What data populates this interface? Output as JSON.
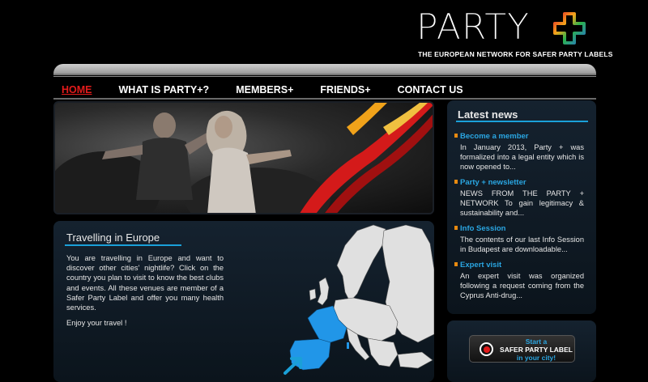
{
  "logo": {
    "word": "PARTY",
    "tagline": "THE EUROPEAN NETWORK FOR SAFER PARTY LABELS"
  },
  "nav": {
    "items": [
      {
        "label": "HOME",
        "active": true
      },
      {
        "label": "WHAT IS PARTY+?",
        "active": false
      },
      {
        "label": "MEMBERS+",
        "active": false
      },
      {
        "label": "FRIENDS+",
        "active": false
      },
      {
        "label": "CONTACT US",
        "active": false
      }
    ]
  },
  "travel": {
    "title": "Travelling in Europe",
    "text": "You are travelling in Europe and want to discover other cities' nightlife? Click on the country you plan to visit to know the best clubs and events. All these venues are member of a Safer Party Label and offer you many health services.",
    "enjoy": "Enjoy your travel !"
  },
  "news": {
    "title": "Latest news",
    "items": [
      {
        "title": "Become a member",
        "text": "In January 2013, Party + was formalized into a legal entity which is now opened to..."
      },
      {
        "title": "Party + newsletter",
        "text": "NEWS FROM THE PARTY + NETWORK To gain legitimacy & sustainability and..."
      },
      {
        "title": "Info Session",
        "text": "The contents of our last Info Session in Budapest are downloadable..."
      },
      {
        "title": "Expert visit",
        "text": "An expert visit was organized following a request coming from the Cyprus Anti-drug..."
      }
    ]
  },
  "cta": {
    "line1": "Start a",
    "line2": "SAFER PARTY LABEL",
    "line3": "in your city!"
  },
  "colors": {
    "accent_blue": "#1aa0d8",
    "active_red": "#e21b1b",
    "highlight_country_blue": "#2196e8"
  }
}
